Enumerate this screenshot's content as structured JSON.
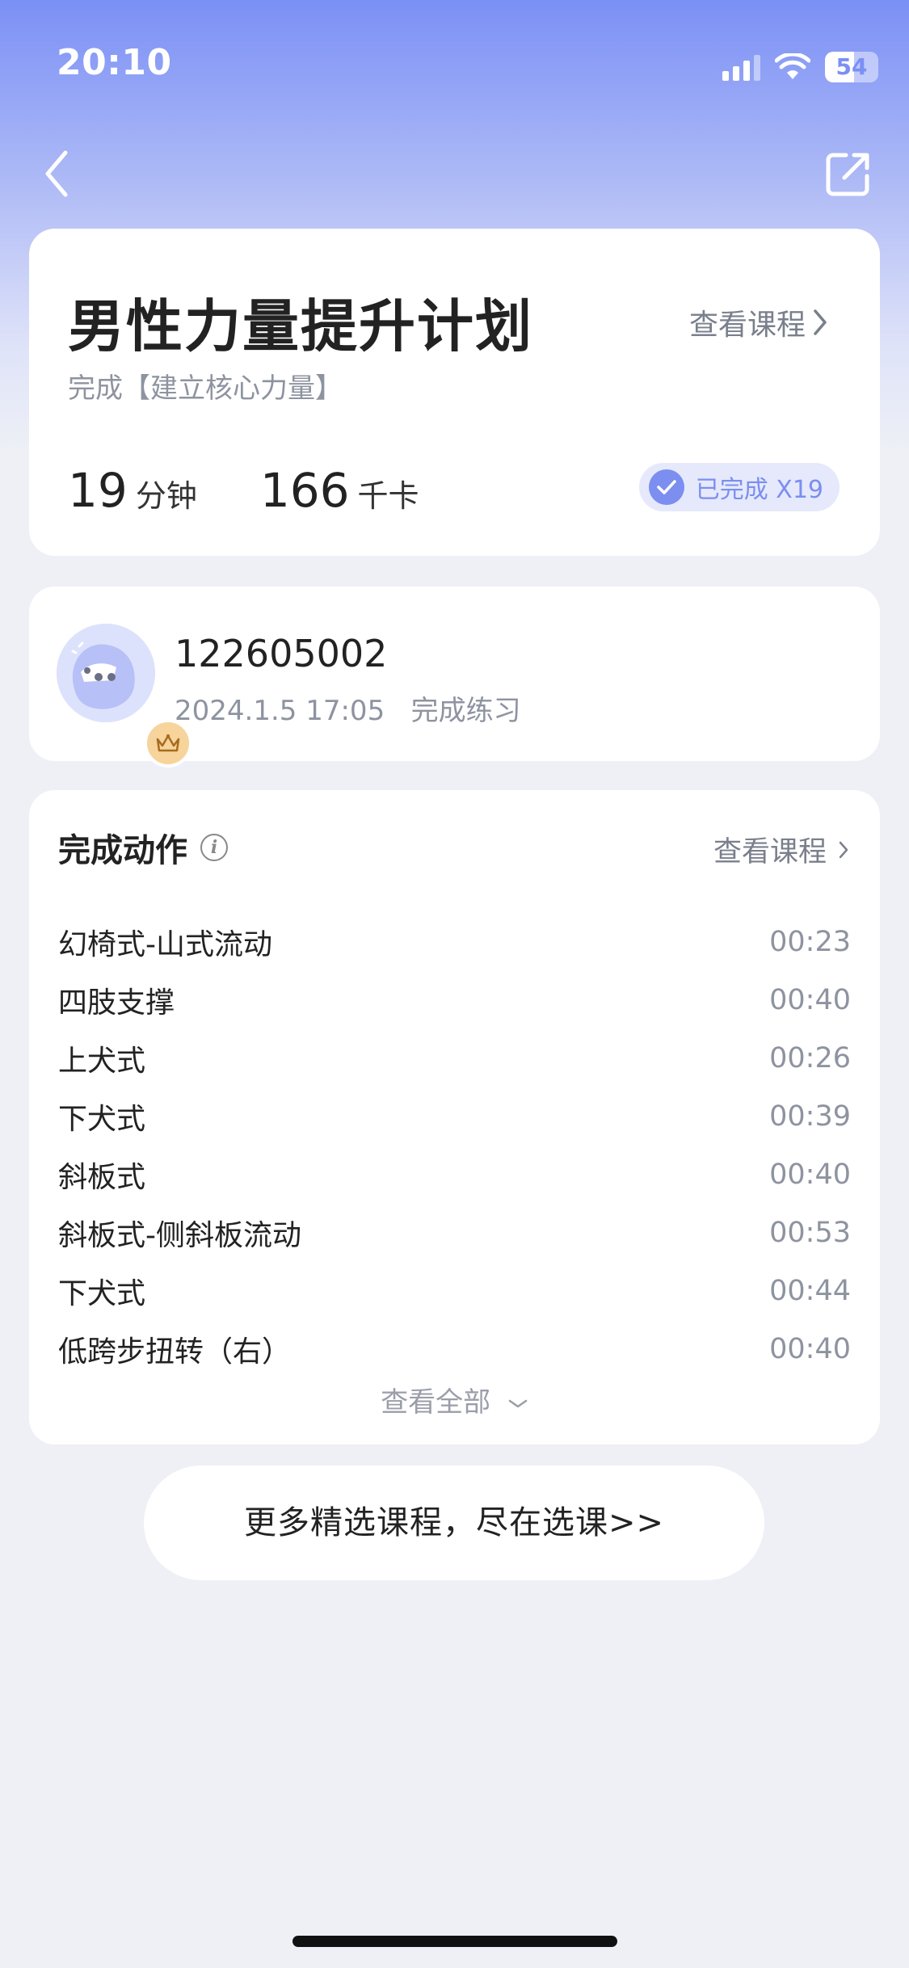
{
  "status_bar": {
    "time": "20:10",
    "battery": "54",
    "battery_level": 0.54
  },
  "plan": {
    "title": "男性力量提升计划",
    "link_label": "查看课程",
    "subtitle": "完成【建立核心力量】",
    "duration_value": "19",
    "duration_unit": "分钟",
    "calories_value": "166",
    "calories_unit": "千卡",
    "completed_label": "已完成 X19"
  },
  "user": {
    "id": "122605002",
    "date": "2024.1.5 17:05",
    "status": "完成练习"
  },
  "actions": {
    "title": "完成动作",
    "link_label": "查看课程",
    "items": [
      {
        "name": "幻椅式-山式流动",
        "time": "00:23"
      },
      {
        "name": "四肢支撑",
        "time": "00:40"
      },
      {
        "name": "上犬式",
        "time": "00:26"
      },
      {
        "name": "下犬式",
        "time": "00:39"
      },
      {
        "name": "斜板式",
        "time": "00:40"
      },
      {
        "name": "斜板式-侧斜板流动",
        "time": "00:53"
      },
      {
        "name": "下犬式",
        "time": "00:44"
      },
      {
        "name": "低跨步扭转（右）",
        "time": "00:40"
      }
    ],
    "view_all_label": "查看全部"
  },
  "more_button": "更多精选课程，尽在选课>>",
  "icons": {
    "back": "back-arrow-icon",
    "share": "share-icon",
    "check": "check-icon",
    "info": "info-icon",
    "crown": "crown-icon",
    "signal": "cellular-signal-icon",
    "wifi": "wifi-icon",
    "battery": "battery-icon"
  },
  "colors": {
    "accent": "#7c8ef0",
    "badge_bg": "#e5e9fb",
    "crown_bg": "#f6d49b"
  }
}
